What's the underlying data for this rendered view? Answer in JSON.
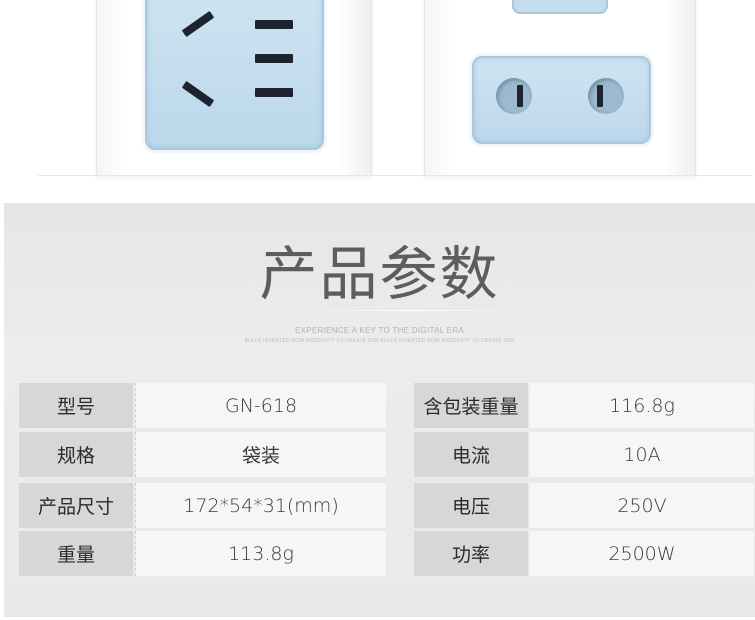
{
  "spec_section": {
    "title": "产品参数",
    "tagline_main": "EXPERIENCE A KEY TO THE DIGITAL ERA",
    "tagline_sub": "BULLS INSERTED ROW INGENUITY TO CREATE USB BULLS INSERTED ROW INGENUITY TO CREATE USB"
  },
  "specs_left": [
    {
      "label": "型号",
      "value": "GN-618"
    },
    {
      "label": "规格",
      "value": "袋装"
    },
    {
      "label": "产品尺寸",
      "value": "172*54*31(mm)"
    },
    {
      "label": "重量",
      "value": "113.8g"
    }
  ],
  "specs_right": [
    {
      "label": "含包装重量",
      "value": "116.8g"
    },
    {
      "label": "电流",
      "value": "10A"
    },
    {
      "label": "电压",
      "value": "250V"
    },
    {
      "label": "功率",
      "value": "2500W"
    }
  ],
  "colors": {
    "socket_panel": "#bcd8ec",
    "socket_border": "#a9c8de",
    "label_cell": "#d7d7d7",
    "value_cell": "#f6f6f6",
    "panel_bg": "#e9e9e9"
  },
  "icons": [
    "power-strip-photo",
    "three-pin-socket-icon",
    "two-pin-socket-icon"
  ]
}
